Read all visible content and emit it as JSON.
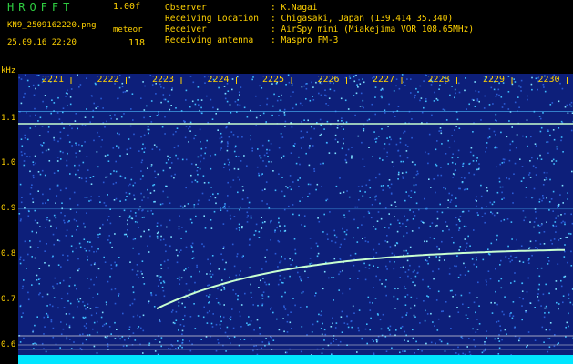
{
  "header": {
    "app_title": "HROFFT",
    "version": "1.00f",
    "filename": "KN9_2509162220.png",
    "mode_label": "meteor",
    "timestamp": "25.09.16 22:20",
    "count": "118"
  },
  "station": [
    {
      "key": "Observer",
      "value": ": K.Nagai"
    },
    {
      "key": "Receiving Location",
      "value": ": Chigasaki, Japan (139.414 35.340)"
    },
    {
      "key": "Receiver",
      "value": ": AirSpy mini (Miakejima VOR 108.65MHz)"
    },
    {
      "key": "Receiving antenna",
      "value": ": Maspro FM-3"
    }
  ],
  "axis": {
    "unit": "kHz",
    "y_ticks": [
      {
        "label": "1.1",
        "value": 1.1
      },
      {
        "label": "1.0",
        "value": 1.0
      },
      {
        "label": "0.9",
        "value": 0.9
      },
      {
        "label": "0.8",
        "value": 0.8
      },
      {
        "label": "0.7",
        "value": 0.7
      },
      {
        "label": "0.6",
        "value": 0.6
      }
    ],
    "x_ticks": [
      "2221",
      "2222",
      "2223",
      "2224",
      "2225",
      "2226",
      "2227",
      "2228",
      "2229",
      "2230"
    ]
  },
  "colors": {
    "background": "#000000",
    "label_text": "#ffd200",
    "title_text": "#2ecc40",
    "spectrogram_base": "#0d1f7a",
    "noise_speckle": "#3fbcff",
    "signal_line": "#c8ffd0",
    "bottom_band": "#00e5ff"
  }
}
